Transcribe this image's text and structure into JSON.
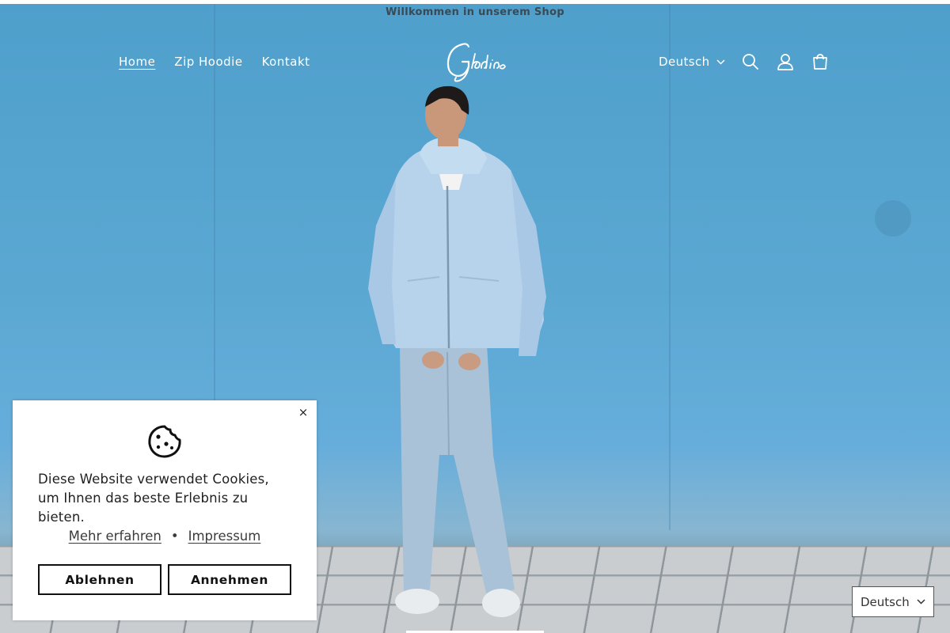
{
  "announcement": "Willkommen in unserem Shop",
  "nav": {
    "items": [
      {
        "label": "Home",
        "active": true
      },
      {
        "label": "Zip Hoodie",
        "active": false
      },
      {
        "label": "Kontakt",
        "active": false
      }
    ]
  },
  "logo": {
    "text": "Gladios"
  },
  "header": {
    "language": "Deutsch",
    "icons": [
      "chevron-down-icon",
      "search-icon",
      "account-icon",
      "cart-icon"
    ]
  },
  "cookie_banner": {
    "message": "Diese Website verwendet Cookies, um Ihnen das beste Erlebnis zu bieten.",
    "link_more": "Mehr erfahren",
    "separator": "•",
    "link_imprint": "Impressum",
    "decline_label": "Ablehnen",
    "accept_label": "Annehmen",
    "close_symbol": "×"
  },
  "footer_language": "Deutsch",
  "colors": {
    "hero_blue": "#5aa6cf",
    "hoodie": "#b7d3ec",
    "jeans": "#a9c2d8",
    "banner_bg": "#ffffff",
    "text_dark": "#1f1f1f"
  }
}
